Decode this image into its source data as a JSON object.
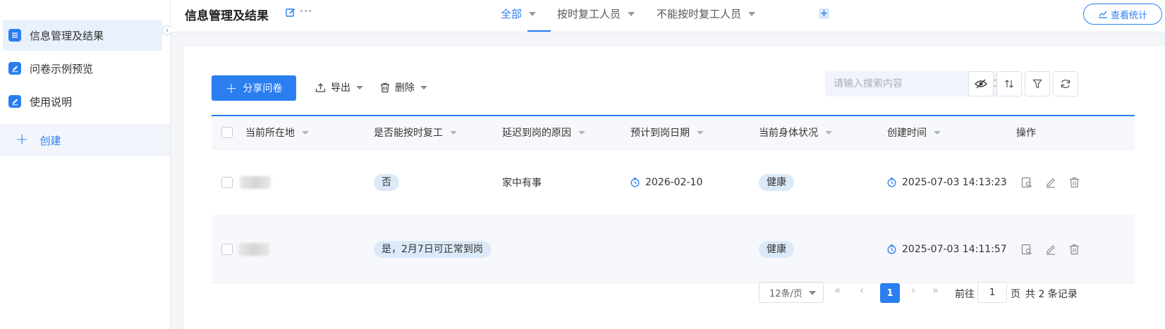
{
  "sidebar": {
    "items": [
      {
        "label": "信息管理及结果",
        "icon": "list-doc-icon",
        "active": true
      },
      {
        "label": "问卷示例预览",
        "icon": "edit-doc-icon",
        "active": false
      },
      {
        "label": "使用说明",
        "icon": "edit-doc-icon",
        "active": false
      }
    ],
    "create_label": "创建",
    "collapse_glyph": "‹"
  },
  "header": {
    "title": "信息管理及结果",
    "more_glyph": "···",
    "tabs": [
      {
        "label": "全部",
        "active": true
      },
      {
        "label": "按时复工人员",
        "active": false
      },
      {
        "label": "不能按时复工人员",
        "active": false
      }
    ],
    "add_tab_glyph": "+",
    "stats_label": "查看统计"
  },
  "toolbar": {
    "share_label": "分享问卷",
    "export_label": "导出",
    "delete_label": "删除",
    "search_placeholder": "请输入搜索内容"
  },
  "table": {
    "columns": [
      "当前所在地",
      "是否能按时复工",
      "延迟到岗的原因",
      "预计到岗日期",
      "当前身体状况",
      "创建时间",
      "操作"
    ],
    "rows": [
      {
        "location": "",
        "on_time": "否",
        "reason": "家中有事",
        "expected_date": "2026-02-10",
        "health": "健康",
        "created": "2025-07-03 14:13:23"
      },
      {
        "location": "",
        "on_time": "是，2月7日可正常到岗",
        "reason": "",
        "expected_date": "",
        "health": "健康",
        "created": "2025-07-03 14:11:57"
      }
    ]
  },
  "pagination": {
    "page_size_label": "12条/页",
    "current_page": "1",
    "goto_label": "前往",
    "goto_value": "1",
    "page_unit": "页",
    "total_label": "共 2 条记录"
  },
  "colors": {
    "accent": "#2a7ef0",
    "tag_bg": "#dbe9f9",
    "sidebar_active_bg": "#e8f1fc"
  }
}
